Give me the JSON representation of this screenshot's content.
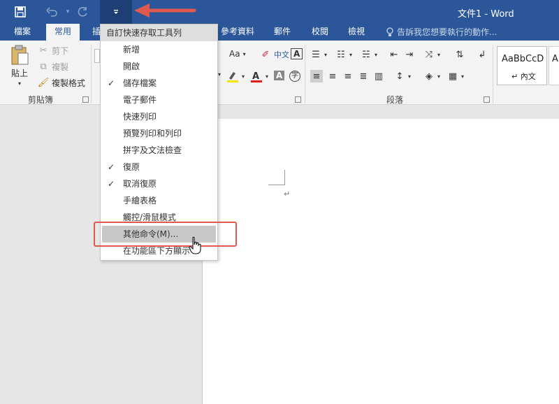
{
  "titlebar": {
    "doc_title": "文件1 - Word",
    "bg": "#2b579a",
    "icons": [
      "save-icon",
      "undo-icon",
      "redo-icon",
      "customize-qat-icon"
    ]
  },
  "tabs": [
    {
      "label": "檔案",
      "active": false
    },
    {
      "label": "常用",
      "active": true
    },
    {
      "label": "插",
      "active": false
    },
    {
      "label": "參考資料",
      "active": false
    },
    {
      "label": "郵件",
      "active": false
    },
    {
      "label": "校閱",
      "active": false
    },
    {
      "label": "檢視",
      "active": false
    }
  ],
  "tellme": {
    "text": "告訴我您想要執行的動作..."
  },
  "ribbon": {
    "clipboard": {
      "paste": "貼上",
      "cut": "剪下",
      "copy": "複製",
      "format_painter": "複製格式",
      "label": "剪貼簿"
    },
    "font": {
      "font_size_btn": "Aa",
      "phonetic": "中文",
      "frame": "A",
      "enclose": "字"
    },
    "paragraph": {
      "label": "段落"
    },
    "styles": {
      "normal_preview": "AaBbCcD",
      "normal_label": "↵ 內文",
      "second_preview": "A"
    }
  },
  "menu": {
    "header": "自訂快速存取工具列",
    "items": [
      {
        "label": "新增",
        "checked": false
      },
      {
        "label": "開啟",
        "checked": false
      },
      {
        "label": "儲存檔案",
        "checked": true
      },
      {
        "label": "電子郵件",
        "checked": false
      },
      {
        "label": "快速列印",
        "checked": false
      },
      {
        "label": "預覽列印和列印",
        "checked": false
      },
      {
        "label": "拼字及文法檢查",
        "checked": false
      },
      {
        "label": "復原",
        "checked": true
      },
      {
        "label": "取消復原",
        "checked": true
      },
      {
        "label": "手繪表格",
        "checked": false
      },
      {
        "label": "觸控/滑鼠模式",
        "checked": false
      },
      {
        "label": "其他命令(M)...",
        "checked": false,
        "highlighted": true
      },
      {
        "label": "在功能區下方顯示",
        "checked": false
      }
    ]
  },
  "document": {
    "paragraph_mark": "↵"
  },
  "colors": {
    "accent": "#2b579a",
    "annotation": "#e0594f"
  }
}
